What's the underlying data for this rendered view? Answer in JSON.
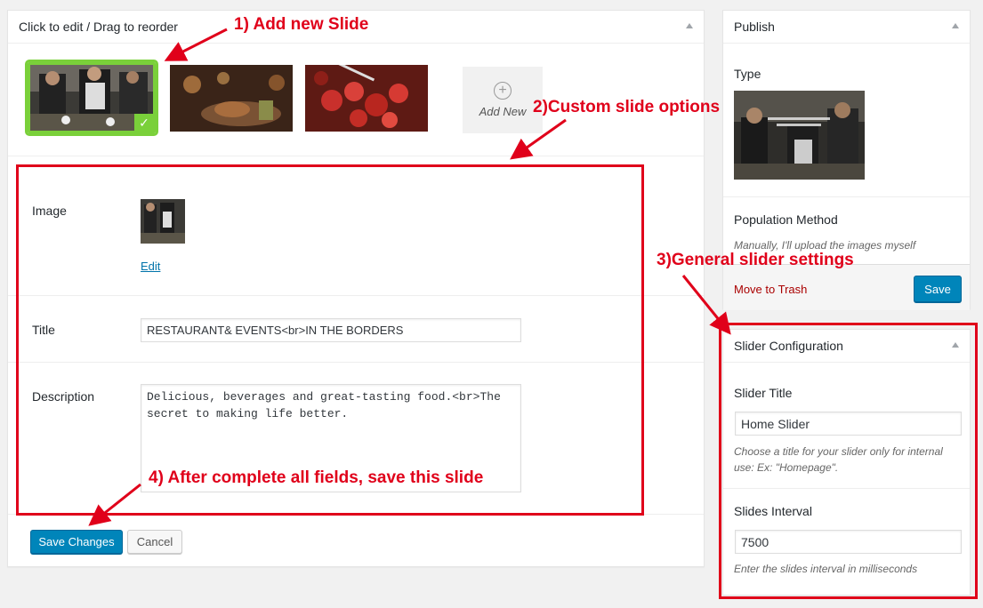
{
  "main_box": {
    "header": "Click to edit / Drag to reorder",
    "add_new_label": "Add New",
    "fields": {
      "image_label": "Image",
      "edit_link": "Edit",
      "title_label": "Title",
      "title_value": "RESTAURANT& EVENTS<br>IN THE BORDERS",
      "description_label": "Description",
      "description_value": "Delicious, beverages and great-tasting food.<br>The secret to making life better."
    },
    "save_button": "Save Changes",
    "cancel_button": "Cancel"
  },
  "publish_box": {
    "header": "Publish",
    "type_label": "Type",
    "population_label": "Population Method",
    "population_value": "Manually, I'll upload the images myself",
    "trash_link": "Move to Trash",
    "save_button": "Save"
  },
  "slider_config_box": {
    "header": "Slider Configuration",
    "title_label": "Slider Title",
    "title_value": "Home Slider",
    "title_help": "Choose a title for your slider only for internal use: Ex: \"Homepage\".",
    "interval_label": "Slides Interval",
    "interval_value": "7500",
    "interval_help": "Enter the slides interval in milliseconds"
  },
  "annotations": {
    "step1": "1) Add new Slide",
    "step2": "2)Custom slide options",
    "step3": "3)General slider settings",
    "step4": "4) After complete all fields, save this slide"
  },
  "colors": {
    "annotation_red": "#e0001a",
    "selected_green": "#7ad03a",
    "primary_blue": "#0085ba",
    "link_blue": "#0073aa",
    "trash_red": "#a00"
  },
  "icons": {
    "checkmark": "checkmark-icon",
    "add": "plus-circle-icon",
    "collapse": "triangle-up-icon"
  }
}
